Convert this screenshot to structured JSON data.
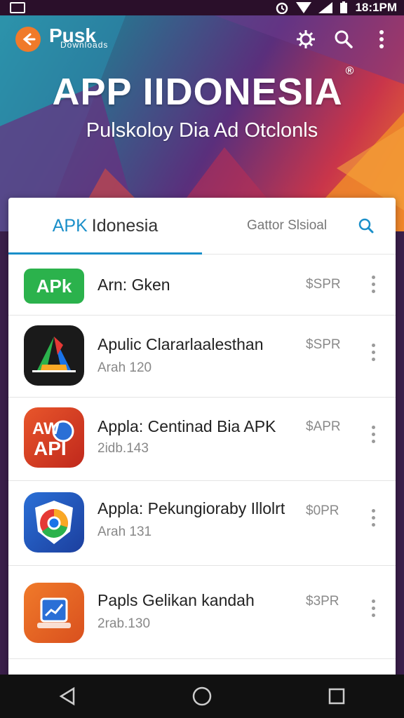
{
  "status_bar": {
    "time": "18:1PM",
    "icons": [
      "gallery-icon",
      "alarm-icon",
      "signal-icon",
      "wifi-icon",
      "battery-icon"
    ]
  },
  "app_bar": {
    "brand_name": "Pusk",
    "brand_tagline": "Downloads",
    "logo_icon": "back-arrow-icon",
    "actions": [
      "settings-icon",
      "search-icon",
      "more-vert-icon"
    ]
  },
  "hero": {
    "title": "APP IIDONESIA",
    "title_mark": "®",
    "subtitle": "Pulskoloy Dia Ad Otclonls"
  },
  "tabs": {
    "active_prefix": "APK",
    "active_rest": "Idonesia",
    "second": "Gattor Slsioal",
    "search_icon": "search-icon"
  },
  "apps": [
    {
      "name": "Arn: Gken",
      "meta": "",
      "price": "$SPR",
      "icon": "apk-text-icon"
    },
    {
      "name": "Apulic Clararlaalesthan",
      "meta": "Arah 120",
      "price": "$SPR",
      "icon": "colorful-a-icon"
    },
    {
      "name": "Appla: Centinad Bia APK",
      "meta": "2idb.143",
      "price": "$APR",
      "icon": "apk-api-icon"
    },
    {
      "name": "Appla: Pekungioraby Illolrt",
      "meta": "Arah 131",
      "price": "$0PR",
      "icon": "chrome-shield-icon"
    },
    {
      "name": "Papls Gelikan kandah",
      "meta": "2rab.130",
      "price": "$3PR",
      "icon": "chart-box-icon"
    }
  ],
  "colors": {
    "accent": "#1a8fc9",
    "orange": "#f07a2a",
    "green": "#2bb24c"
  }
}
